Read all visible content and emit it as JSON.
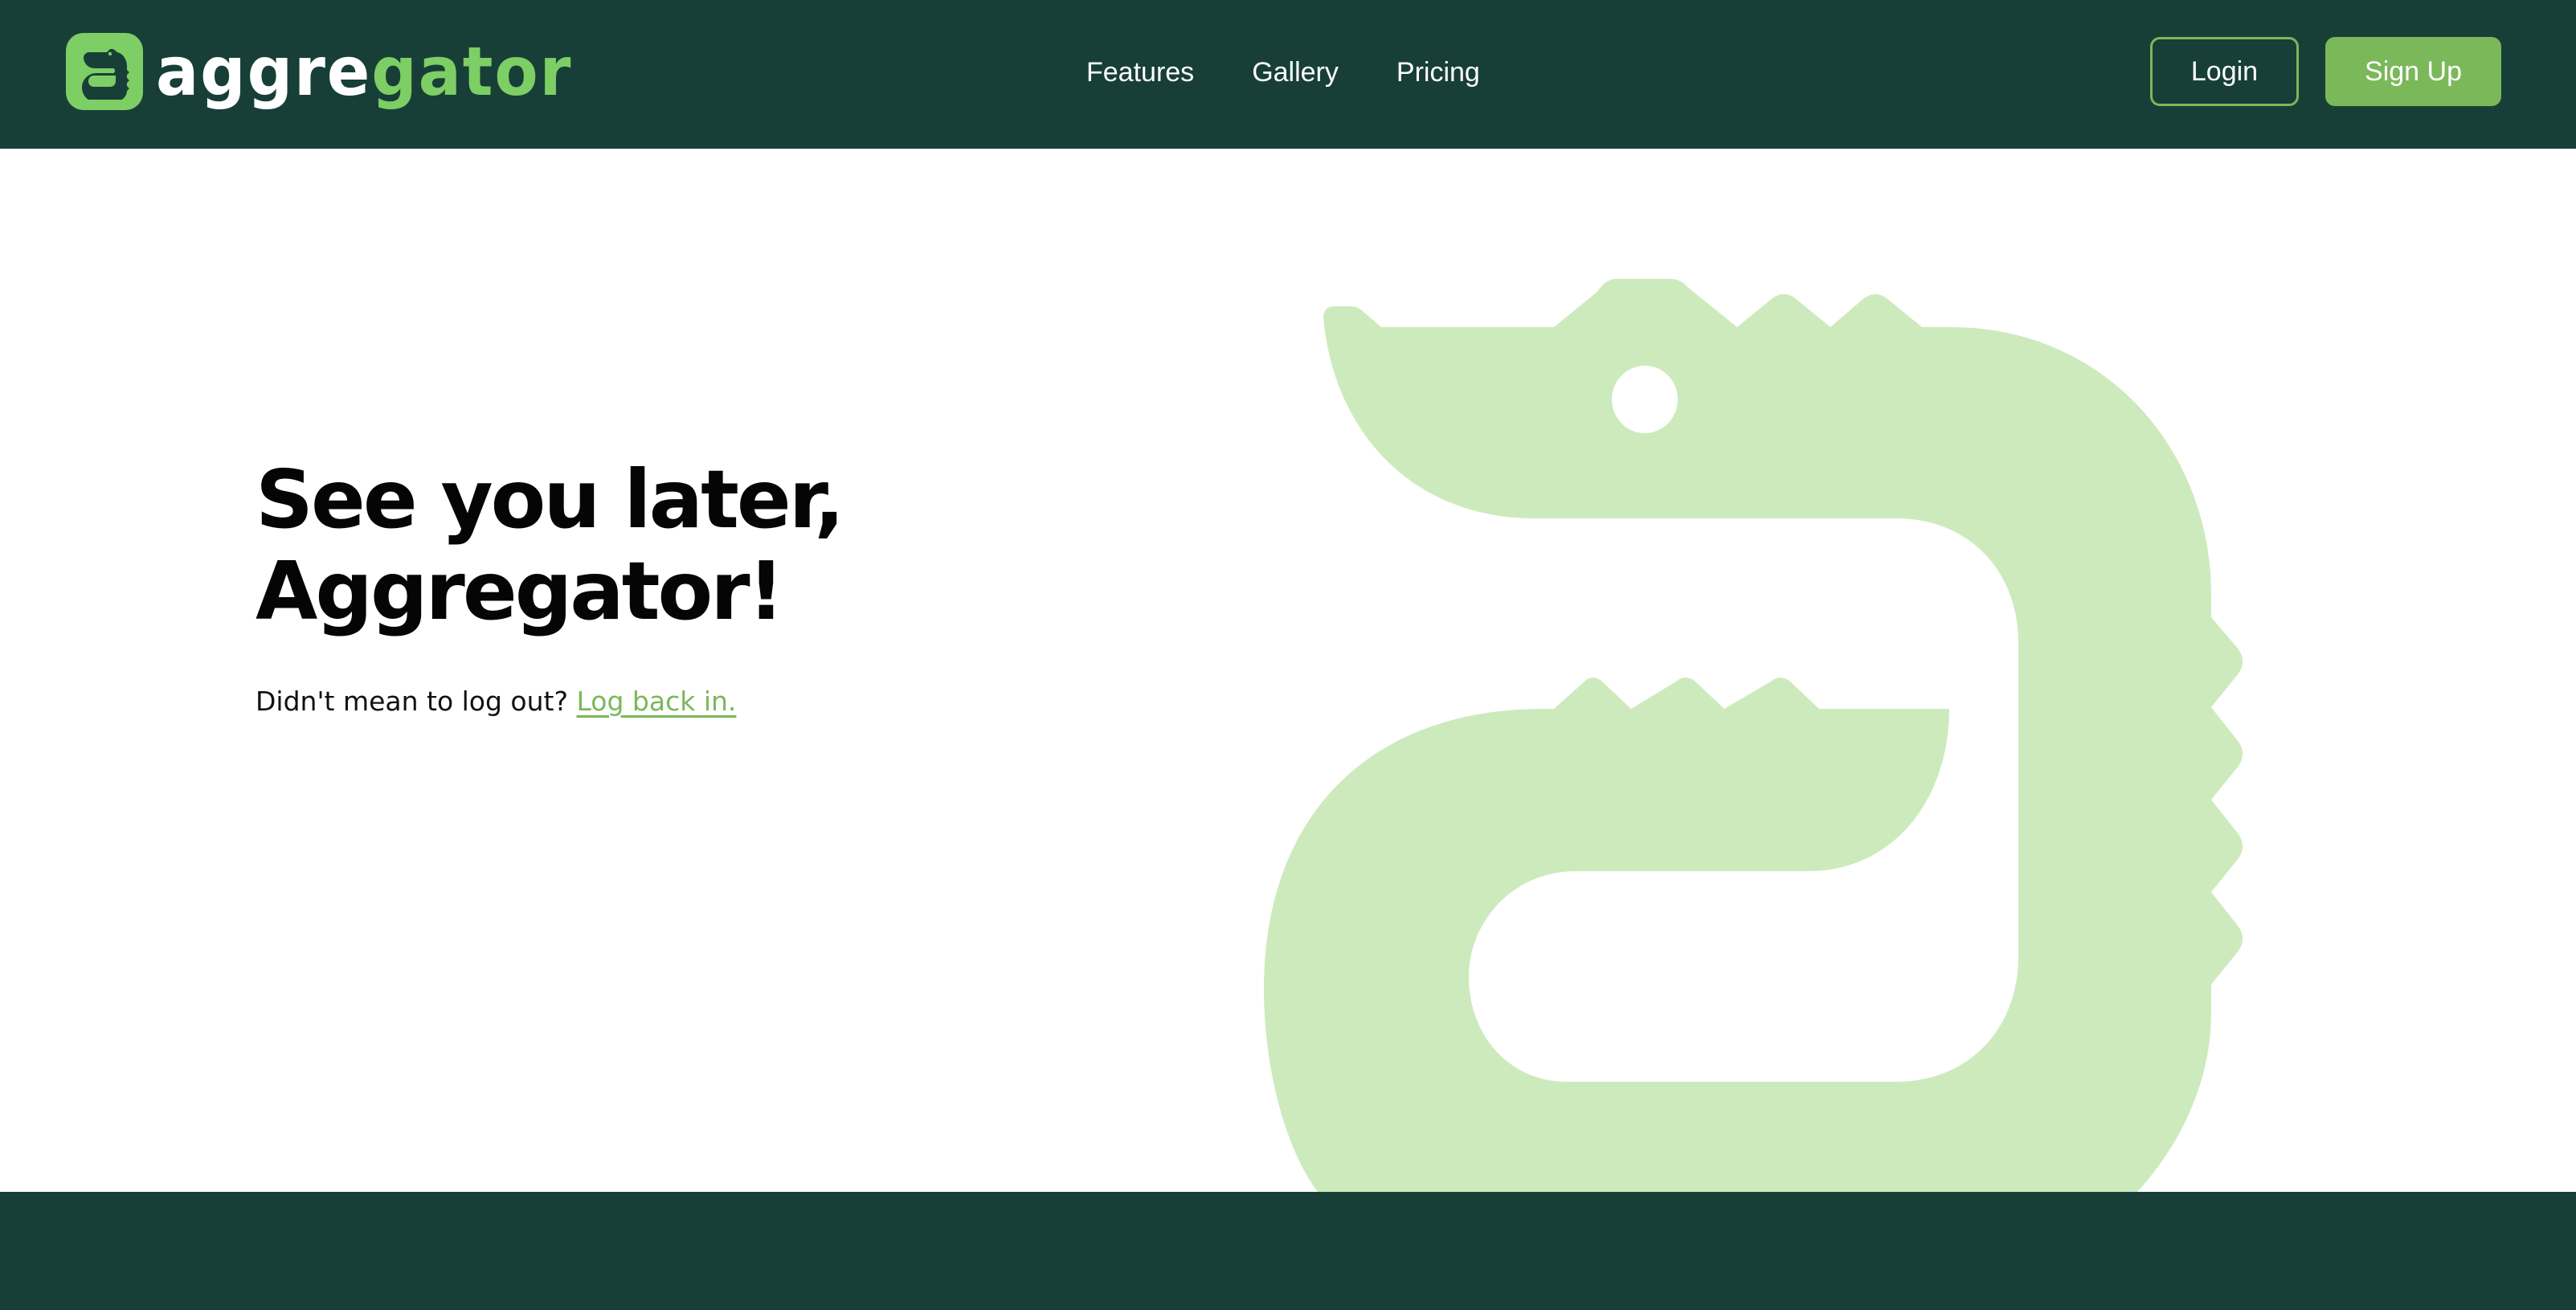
{
  "brand": {
    "name_part1": "aggre",
    "name_part2": "gator",
    "logo_icon": "alligator-a-icon"
  },
  "nav": {
    "items": [
      {
        "label": "Features"
      },
      {
        "label": "Gallery"
      },
      {
        "label": "Pricing"
      }
    ]
  },
  "auth": {
    "login_label": "Login",
    "signup_label": "Sign Up"
  },
  "hero": {
    "title_line1": "See you later,",
    "title_line2": "Aggregator!",
    "subtitle": "Didn't mean to log out?",
    "link_label": "Log back in."
  },
  "illustration": {
    "icon": "alligator-illustration"
  },
  "colors": {
    "header_bg": "#183f37",
    "brand_green": "#7dce64",
    "button_green": "#7ab85a",
    "illustration_green": "#cdeabd",
    "footer_bg": "#183f37"
  }
}
